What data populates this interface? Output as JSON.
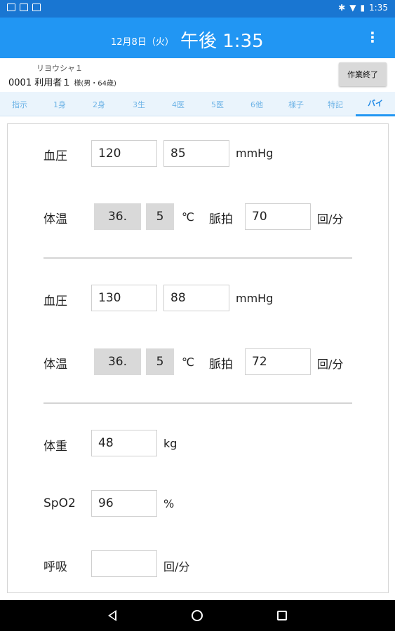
{
  "statusbar": {
    "time": "1:35"
  },
  "header": {
    "date": "12月8日（火）",
    "time": "午後 1:35",
    "menu_icon": "more-vert-icon"
  },
  "user": {
    "kana": "リヨウシャ１",
    "id": "0001",
    "name": "利用者１",
    "suffix": "様(男・64歳)",
    "end_button": "作業終了"
  },
  "tabs": [
    "指示",
    "1身",
    "2身",
    "3生",
    "4医",
    "5医",
    "6他",
    "様子",
    "特記",
    "バイ"
  ],
  "vitals": {
    "set1": {
      "bp_label": "血圧",
      "bp_systolic": "120",
      "bp_diastolic": "85",
      "bp_unit": "mmHg",
      "temp_label": "体温",
      "temp_int": "36.",
      "temp_dec": "5",
      "temp_unit": "℃",
      "pulse_label": "脈拍",
      "pulse": "70",
      "pulse_unit": "回/分"
    },
    "set2": {
      "bp_label": "血圧",
      "bp_systolic": "130",
      "bp_diastolic": "88",
      "bp_unit": "mmHg",
      "temp_label": "体温",
      "temp_int": "36.",
      "temp_dec": "5",
      "temp_unit": "℃",
      "pulse_label": "脈拍",
      "pulse": "72",
      "pulse_unit": "回/分"
    },
    "weight_label": "体重",
    "weight": "48",
    "weight_unit": "kg",
    "spo2_label": "SpO2",
    "spo2": "96",
    "spo2_unit": "%",
    "resp_label": "呼吸",
    "resp": "",
    "resp_unit": "回/分"
  },
  "colors": {
    "appbar": "#2196f3",
    "statusbar": "#1976d2",
    "tab_active": "#1e88e5"
  }
}
